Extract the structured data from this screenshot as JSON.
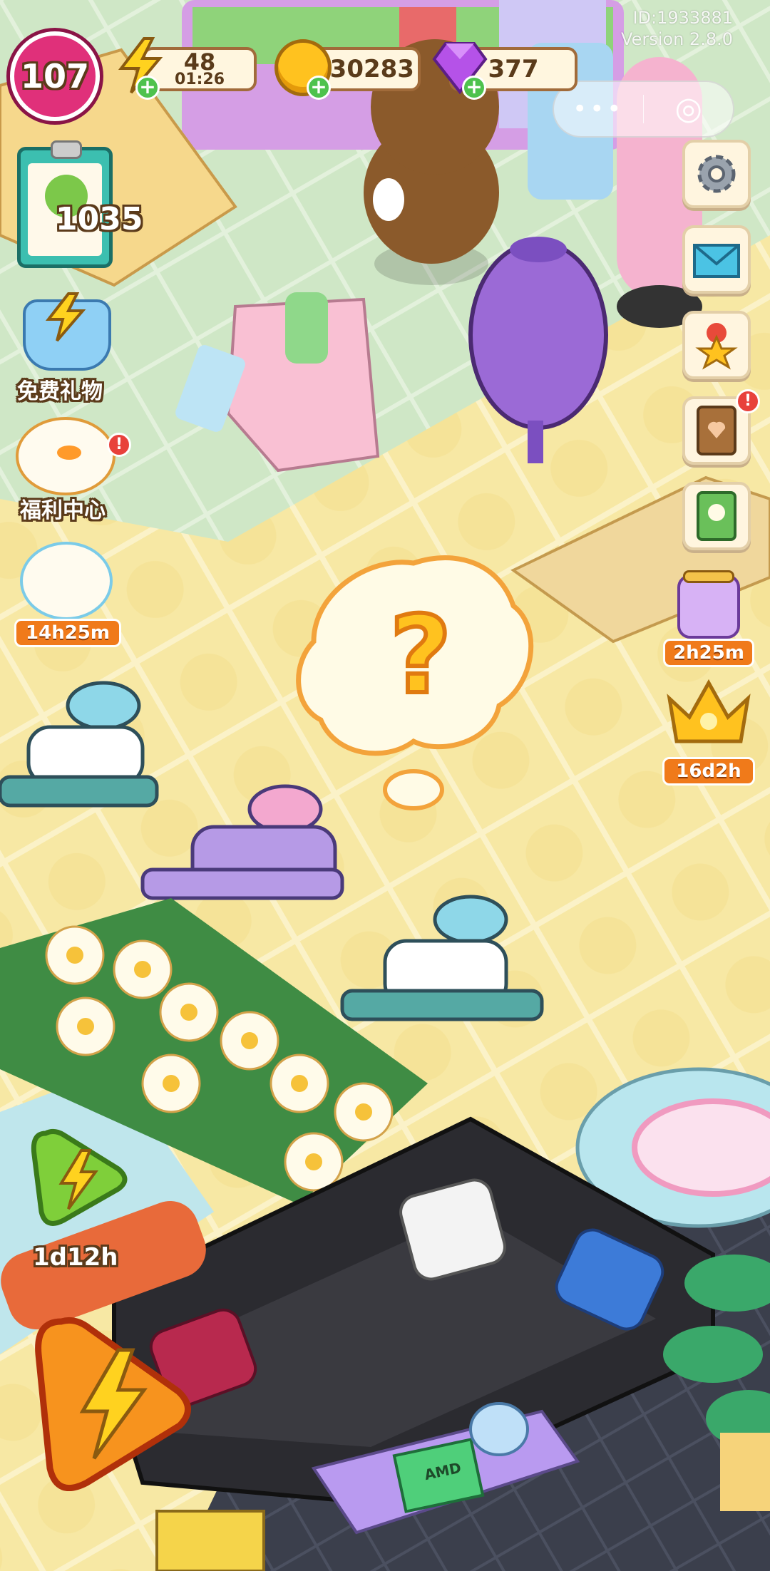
{
  "hud": {
    "level": "107",
    "energy": {
      "value": "48",
      "timer": "01:26",
      "plus": "+"
    },
    "coins": {
      "value": "130283",
      "plus": "+"
    },
    "gems": {
      "value": "377",
      "plus": "+"
    },
    "task_count": "1035"
  },
  "watermark": {
    "id": "ID:1933881",
    "version": "Version 2.8.0"
  },
  "capsule": {
    "more": "•••",
    "close": "◎"
  },
  "left_menu": {
    "free_gift": "免费礼物",
    "welfare_center": "福利中心",
    "welfare_badge": "!",
    "event_timer": "14h25m"
  },
  "right_menu": {
    "book_badge": "!",
    "gem_jar_timer": "2h25m",
    "crown_timer": "16d2h"
  },
  "scene": {
    "thought": "?"
  },
  "bottom": {
    "green_boost_timer": "1d12h",
    "laptop_text": "AMD"
  },
  "colors": {
    "accent_orange": "#f07a1a",
    "level_pink": "#e0307a",
    "plus_green": "#4ec24e",
    "badge_red": "#e8413b"
  }
}
